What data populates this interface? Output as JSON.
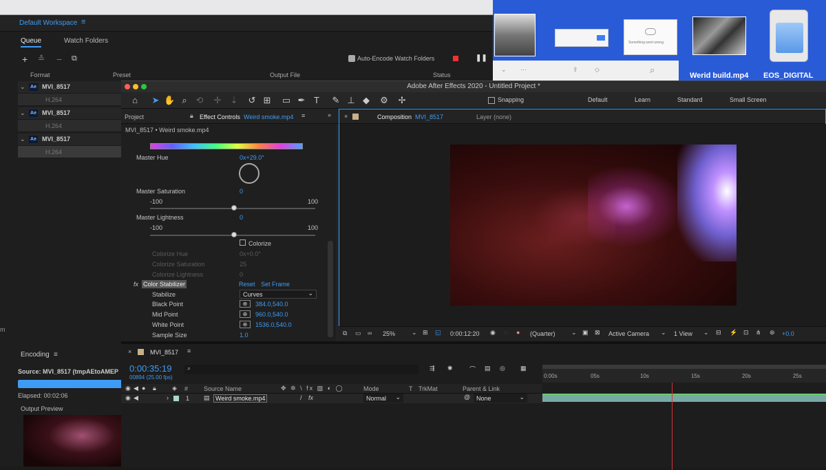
{
  "media_encoder": {
    "workspace": "Default Workspace",
    "tabs": [
      "Queue",
      "Watch Folders"
    ],
    "auto_encode_label": "Auto-Encode Watch Folders",
    "columns": {
      "format": "Format",
      "preset": "Preset",
      "output_file": "Output File",
      "status": "Status"
    },
    "queue": [
      {
        "name": "MVI_8517",
        "format": "H.264"
      },
      {
        "name": "MVI_8517",
        "format": "H.264"
      },
      {
        "name": "MVI_8517",
        "format": "H.264"
      }
    ],
    "encoding_title": "Encoding",
    "source": "Source: MVI_8517 (tmpAEtoAMEP",
    "elapsed": "Elapsed: 00:02:06",
    "output_preview": "Output Preview",
    "side_label": "m"
  },
  "desktop": {
    "file1": "Werid build.mp4",
    "file2": "EOS_DIGITAL",
    "dialog_text": "Something went wrong."
  },
  "ae": {
    "title": "Adobe After Effects 2020 - Untitled Project *",
    "snapping": "Snapping",
    "workspaces": [
      "Default",
      "Learn",
      "Standard",
      "Small Screen"
    ],
    "panel_project": "Project",
    "effect_controls_label": "Effect Controls",
    "effect_controls_target": "Weird smoke.mp4",
    "layer_path": "MVI_8517 • Weird smoke.mp4",
    "master_hue": {
      "label": "Master Hue",
      "value": "0x+29.0°"
    },
    "master_saturation": {
      "label": "Master Saturation",
      "value": "0",
      "min": "-100",
      "max": "100"
    },
    "master_lightness": {
      "label": "Master Lightness",
      "value": "0",
      "min": "-100",
      "max": "100"
    },
    "colorize_label": "Colorize",
    "colorize_hue": {
      "label": "Colorize Hue",
      "value": "0x+0.0°"
    },
    "colorize_saturation": {
      "label": "Colorize Saturation",
      "value": "25"
    },
    "colorize_lightness": {
      "label": "Colorize Lightness",
      "value": "0"
    },
    "color_stabilizer": {
      "label": "Color Stabilizer",
      "reset": "Reset",
      "set_frame": "Set Frame"
    },
    "stabilize": {
      "label": "Stabilize",
      "value": "Curves"
    },
    "black_point": {
      "label": "Black Point",
      "value": "384.0,540.0"
    },
    "mid_point": {
      "label": "Mid Point",
      "value": "960.0,540.0"
    },
    "white_point": {
      "label": "White Point",
      "value": "1536.0,540.0"
    },
    "sample_size": {
      "label": "Sample Size",
      "value": "1.0"
    },
    "composition_label": "Composition",
    "composition_name": "MVI_8517",
    "layer_panel": "Layer (none)",
    "viewer": {
      "zoom": "25%",
      "timecode": "0:00:12:20",
      "resolution": "(Quarter)",
      "camera": "Active Camera",
      "views": "1 View",
      "exposure": "+0.0"
    },
    "timeline": {
      "comp": "MVI_8517",
      "current_time": "0:00:35:19",
      "frame_info": "00894 (25.00 fps)",
      "columns": {
        "num": "#",
        "source": "Source Name",
        "mode": "Mode",
        "t": "T",
        "trkmat": "TrkMat",
        "parent": "Parent & Link"
      },
      "layer": {
        "index": "1",
        "name": "Weird smoke.mp4",
        "mode": "Normal",
        "parent": "None"
      },
      "ruler": [
        "0:00s",
        "05s",
        "10s",
        "15s",
        "20s",
        "25s"
      ]
    }
  }
}
